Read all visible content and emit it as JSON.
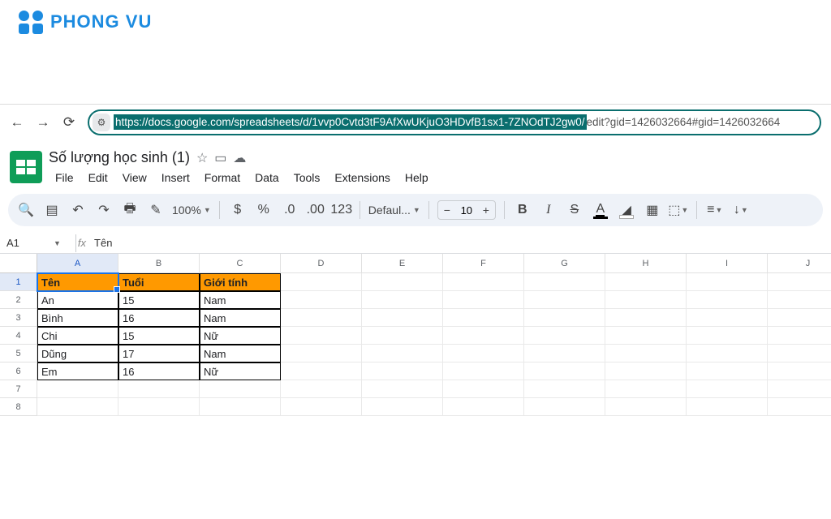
{
  "logo": {
    "text": "PHONG VU"
  },
  "browser": {
    "url_selected": "https://docs.google.com/spreadsheets/d/1vvp0Cvtd3tF9AfXwUKjuO3HDvfB1sx1-7ZNOdTJ2gw0/",
    "url_rest": "edit?gid=1426032664#gid=1426032664"
  },
  "doc": {
    "title": "Số lượng học sinh (1)",
    "menus": [
      "File",
      "Edit",
      "View",
      "Insert",
      "Format",
      "Data",
      "Tools",
      "Extensions",
      "Help"
    ]
  },
  "toolbar": {
    "zoom": "100%",
    "number_format": "123",
    "font": "Defaul...",
    "font_size": "10"
  },
  "namebox": {
    "ref": "A1",
    "formula": "Tên"
  },
  "columns": [
    "A",
    "B",
    "C",
    "D",
    "E",
    "F",
    "G",
    "H",
    "I",
    "J"
  ],
  "rows": [
    "1",
    "2",
    "3",
    "4",
    "5",
    "6",
    "7",
    "8"
  ],
  "table": {
    "headers": [
      "Tên",
      "Tuổi",
      "Giới tính"
    ],
    "data": [
      [
        "An",
        "15",
        "Nam"
      ],
      [
        "Bình",
        "16",
        "Nam"
      ],
      [
        "Chi",
        "15",
        "Nữ"
      ],
      [
        "Dũng",
        "17",
        "Nam"
      ],
      [
        "Em",
        "16",
        "Nữ"
      ]
    ]
  }
}
